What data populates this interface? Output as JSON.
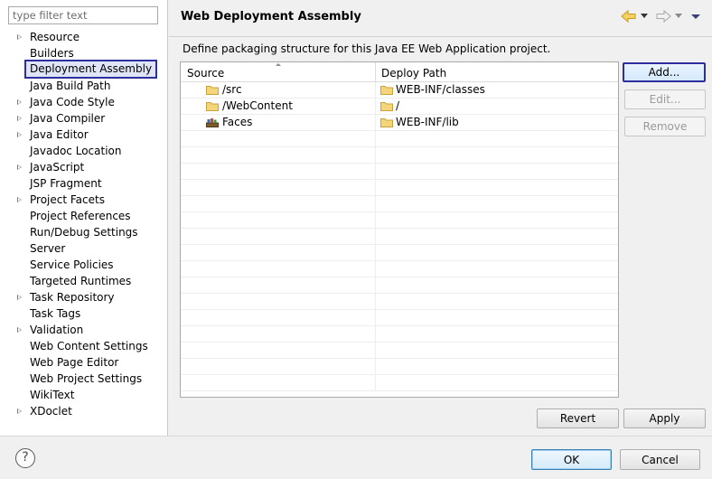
{
  "filter": {
    "placeholder": "type filter text"
  },
  "sidebar": {
    "items": [
      {
        "label": "Resource",
        "expandable": true,
        "selected": false
      },
      {
        "label": "Builders",
        "expandable": false,
        "selected": false
      },
      {
        "label": "Deployment Assembly",
        "expandable": false,
        "selected": true
      },
      {
        "label": "Java Build Path",
        "expandable": false,
        "selected": false
      },
      {
        "label": "Java Code Style",
        "expandable": true,
        "selected": false
      },
      {
        "label": "Java Compiler",
        "expandable": true,
        "selected": false
      },
      {
        "label": "Java Editor",
        "expandable": true,
        "selected": false
      },
      {
        "label": "Javadoc Location",
        "expandable": false,
        "selected": false
      },
      {
        "label": "JavaScript",
        "expandable": true,
        "selected": false
      },
      {
        "label": "JSP Fragment",
        "expandable": false,
        "selected": false
      },
      {
        "label": "Project Facets",
        "expandable": true,
        "selected": false
      },
      {
        "label": "Project References",
        "expandable": false,
        "selected": false
      },
      {
        "label": "Run/Debug Settings",
        "expandable": false,
        "selected": false
      },
      {
        "label": "Server",
        "expandable": false,
        "selected": false
      },
      {
        "label": "Service Policies",
        "expandable": false,
        "selected": false
      },
      {
        "label": "Targeted Runtimes",
        "expandable": false,
        "selected": false
      },
      {
        "label": "Task Repository",
        "expandable": true,
        "selected": false
      },
      {
        "label": "Task Tags",
        "expandable": false,
        "selected": false
      },
      {
        "label": "Validation",
        "expandable": true,
        "selected": false
      },
      {
        "label": "Web Content Settings",
        "expandable": false,
        "selected": false
      },
      {
        "label": "Web Page Editor",
        "expandable": false,
        "selected": false
      },
      {
        "label": "Web Project Settings",
        "expandable": false,
        "selected": false
      },
      {
        "label": "WikiText",
        "expandable": false,
        "selected": false
      },
      {
        "label": "XDoclet",
        "expandable": true,
        "selected": false
      }
    ]
  },
  "header": {
    "title": "Web Deployment Assembly",
    "icons": [
      "back-arrow-icon",
      "forward-arrow-icon",
      "view-menu-icon"
    ]
  },
  "main": {
    "description": "Define packaging structure for this Java EE Web Application project.",
    "table": {
      "columns": [
        "Source",
        "Deploy Path"
      ],
      "rows": [
        {
          "source": "/src",
          "source_icon": "folder-icon",
          "deploy": "WEB-INF/classes",
          "deploy_icon": "folder-icon"
        },
        {
          "source": "/WebContent",
          "source_icon": "folder-icon",
          "deploy": "/",
          "deploy_icon": "folder-icon"
        },
        {
          "source": "Faces",
          "source_icon": "library-icon",
          "deploy": "WEB-INF/lib",
          "deploy_icon": "folder-icon"
        }
      ],
      "empty_rows": 16
    },
    "buttons": {
      "add": "Add...",
      "edit": "Edit...",
      "remove": "Remove"
    },
    "revert": "Revert",
    "apply": "Apply"
  },
  "footer": {
    "help": "?",
    "ok": "OK",
    "cancel": "Cancel"
  },
  "colors": {
    "selection_border": "#2d2f9e",
    "folder_fill": "#f5d57a",
    "folder_stroke": "#c9a23c",
    "nav_arrow": "#e3b43a"
  }
}
